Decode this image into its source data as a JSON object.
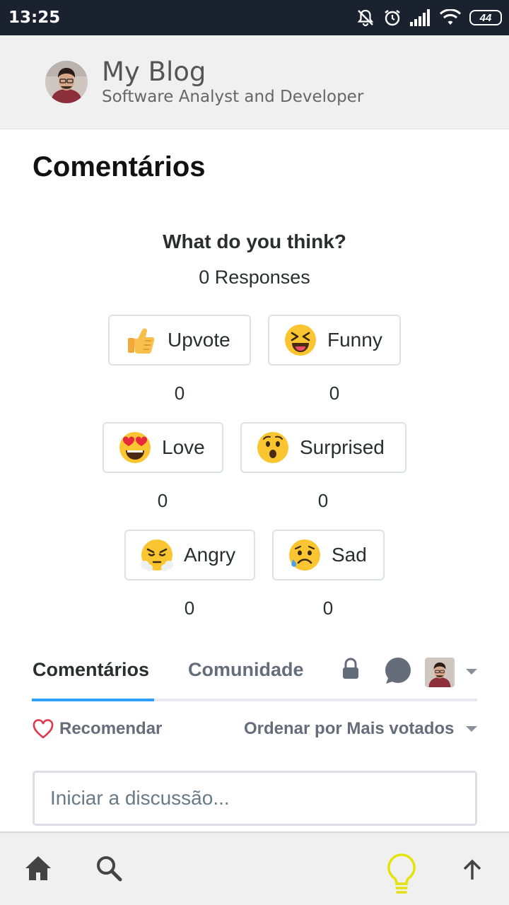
{
  "status_bar": {
    "time": "13:25",
    "battery": "44"
  },
  "blog": {
    "title": "My Blog",
    "subtitle": "Software Analyst and Developer"
  },
  "section_title": "Comentários",
  "reactions_widget": {
    "question": "What do you think?",
    "responses": "0 Responses",
    "reactions": [
      {
        "label": "Upvote",
        "count": "0",
        "emoji": "thumbs-up"
      },
      {
        "label": "Funny",
        "count": "0",
        "emoji": "squinting-tongue"
      },
      {
        "label": "Love",
        "count": "0",
        "emoji": "heart-eyes"
      },
      {
        "label": "Surprised",
        "count": "0",
        "emoji": "surprised"
      },
      {
        "label": "Angry",
        "count": "0",
        "emoji": "steam-from-nose"
      },
      {
        "label": "Sad",
        "count": "0",
        "emoji": "sad-sweat"
      }
    ]
  },
  "comments_nav": {
    "tab_comments": "Comentários",
    "tab_community": "Comunidade",
    "recommend": "Recomendar",
    "sort": "Ordenar por Mais votados"
  },
  "discussion": {
    "placeholder": "Iniciar a discussão..."
  },
  "colors": {
    "accent": "#2e9fff",
    "status_bar": "#1a222f",
    "bulb": "#e3e20f",
    "heart": "#e0394e"
  }
}
